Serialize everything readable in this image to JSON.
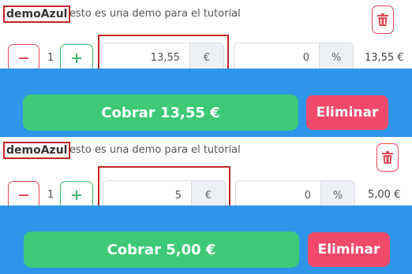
{
  "items": [
    {
      "name": "demoAzul",
      "description": "esto es una demo para el tutorial",
      "quantity": "1",
      "price": "13,55",
      "price_unit": "€",
      "discount": "0",
      "discount_unit": "%",
      "total": "13,55 €",
      "charge_label": "Cobrar 13,55 €",
      "delete_label": "Eliminar"
    },
    {
      "name": "demoAzul",
      "description": "esto es una demo para el tutorial",
      "quantity": "1",
      "price": "5",
      "price_unit": "€",
      "discount": "0",
      "discount_unit": "%",
      "total": "5,00 €",
      "charge_label": "Cobrar 5,00 €",
      "delete_label": "Eliminar"
    }
  ],
  "colors": {
    "primary_blue": "#2f95e8",
    "success_green": "#3ec977",
    "danger_pink": "#f0496a",
    "danger_outline": "#e34a57",
    "highlight_red": "#c12525"
  },
  "icons": {
    "trash": "trash-icon",
    "minus": "minus-icon",
    "plus": "plus-icon"
  }
}
